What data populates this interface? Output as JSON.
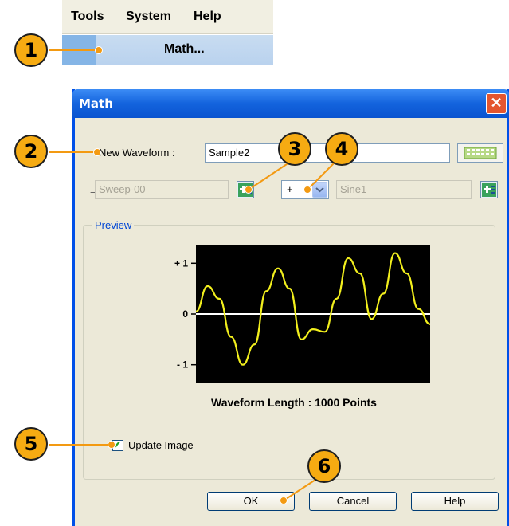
{
  "menu": {
    "items": [
      "Tools",
      "System",
      "Help"
    ],
    "submenu_item": "Math..."
  },
  "callouts": [
    "1",
    "2",
    "3",
    "4",
    "5",
    "6"
  ],
  "dialog": {
    "title": "Math",
    "close_glyph": "✕",
    "new_waveform_label": "New Waveform :",
    "new_waveform_value": "Sample2",
    "equals_sign": "=",
    "operand1": "Sweep-00",
    "operator": "+",
    "operand2": "Sine1",
    "preview_label": "Preview",
    "waveform_length": "Waveform Length : 1000 Points",
    "update_image_label": "Update Image",
    "update_image_checked": true,
    "ok_label": "OK",
    "cancel_label": "Cancel",
    "help_label": "Help",
    "check_glyph": "✔"
  },
  "chart_data": {
    "type": "line",
    "y_tick_labels": [
      "+ 1",
      "0",
      "- 1"
    ],
    "ylim": [
      -1.35,
      1.35
    ],
    "x": [
      0,
      0.05,
      0.1,
      0.15,
      0.2,
      0.25,
      0.3,
      0.35,
      0.4,
      0.45,
      0.5,
      0.55,
      0.6,
      0.65,
      0.7,
      0.75,
      0.8,
      0.85,
      0.9,
      0.95,
      1.0
    ],
    "values": [
      0.05,
      0.55,
      0.3,
      -0.45,
      -1.0,
      -0.6,
      0.45,
      0.9,
      0.5,
      -0.5,
      -0.3,
      -0.35,
      0.3,
      1.1,
      0.8,
      -0.1,
      0.4,
      1.2,
      0.8,
      0.1,
      -0.2
    ],
    "background": "#000000",
    "series_color": "#f2ef1d",
    "zero_line_color": "#ffffff"
  },
  "colors": {
    "callout_fill": "#f6ab12",
    "title_bar": "#1363dd",
    "dialog_body": "#ece9d8"
  },
  "icons": [
    "add-waveform-icon",
    "dropdown-arrow-icon",
    "keyboard-icon",
    "close-icon"
  ]
}
